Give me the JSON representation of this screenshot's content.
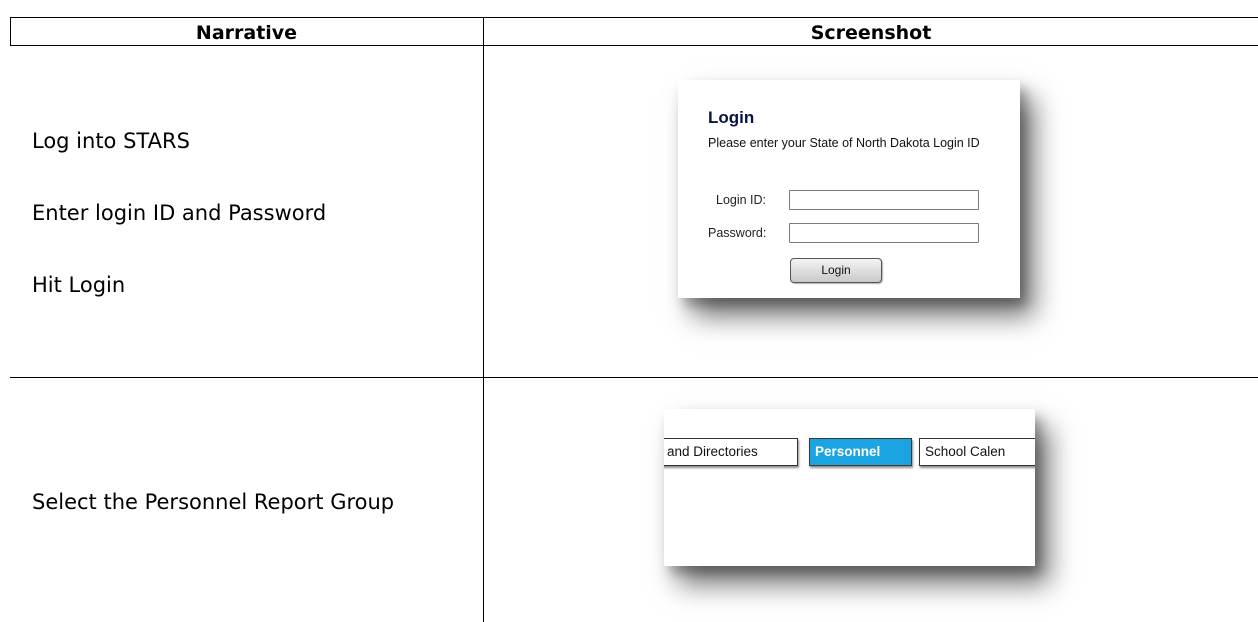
{
  "table": {
    "headers": {
      "narrative": "Narrative",
      "screenshot": "Screenshot"
    },
    "rows": [
      {
        "narrative": [
          "Log into STARS",
          "Enter login ID and Password",
          "Hit Login"
        ],
        "screenshot": {
          "title": "Login",
          "subtitle": "Please enter your State of North Dakota Login ID",
          "login_id_label": "Login ID:",
          "password_label": "Password:",
          "login_id_value": "",
          "password_value": "",
          "button_label": "Login"
        }
      },
      {
        "narrative": [
          "Select the Personnel Report Group"
        ],
        "screenshot": {
          "tabs": [
            {
              "label": "and Directories",
              "selected": false
            },
            {
              "label": "Personnel",
              "selected": true
            },
            {
              "label": "School Calen",
              "selected": false
            }
          ]
        }
      }
    ]
  },
  "colors": {
    "selected_tab": "#1aa4e1",
    "login_title": "#0a1440"
  }
}
